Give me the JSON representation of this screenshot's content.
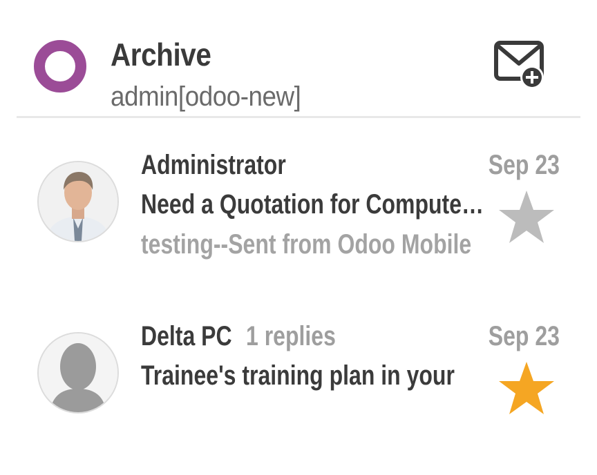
{
  "header": {
    "title": "Archive",
    "subtitle": "admin[odoo-new]",
    "logo_color": "#9b4c97",
    "compose_icon": "compose-mail-icon"
  },
  "messages": [
    {
      "sender": "Administrator",
      "replies": "",
      "date": "Sep 23",
      "subject": "Need a Quotation for Compute…",
      "preview": "testing--Sent from Odoo Mobile",
      "starred": false,
      "avatar": "administrator-photo"
    },
    {
      "sender": "Delta PC",
      "replies": "1 replies",
      "date": "Sep 23",
      "subject": "Trainee's training plan in your",
      "preview": "",
      "starred": true,
      "avatar": "default-avatar"
    }
  ],
  "colors": {
    "star_inactive": "#bcbcbc",
    "star_active": "#f5a623",
    "divider": "#e8e8e8"
  }
}
